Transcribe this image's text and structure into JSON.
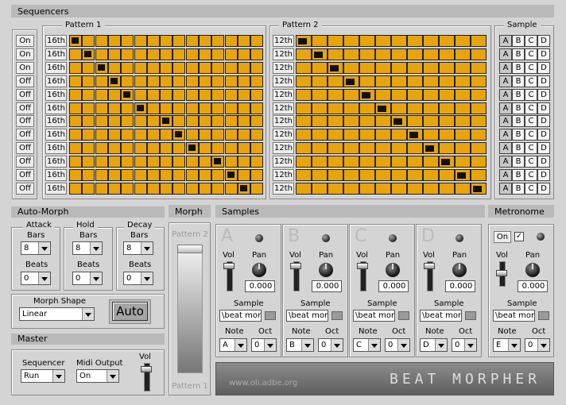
{
  "sequencers": {
    "title": "Sequencers",
    "pattern1_title": "Pattern 1",
    "pattern2_title": "Pattern 2",
    "sample_title": "Sample",
    "onoff": [
      "On",
      "On",
      "On",
      "Off",
      "Off",
      "Off",
      "Off",
      "Off",
      "Off",
      "Off",
      "Off",
      "Off"
    ],
    "p1_div": [
      "16th",
      "16th",
      "16th",
      "16th",
      "16th",
      "16th",
      "16th",
      "16th",
      "16th",
      "16th",
      "16th",
      "16th"
    ],
    "p2_div": [
      "12th",
      "12th",
      "12th",
      "12th",
      "12th",
      "12th",
      "12th",
      "12th",
      "12th",
      "12th",
      "12th",
      "12th"
    ],
    "p1_active": [
      0,
      1,
      2,
      3,
      4,
      5,
      7,
      8,
      9,
      11,
      12,
      13
    ],
    "p2_active": [
      0,
      1,
      2,
      3,
      4,
      5,
      6,
      7,
      8,
      9,
      10,
      11
    ],
    "sample_letters": [
      "A",
      "B",
      "C",
      "D"
    ]
  },
  "automorph": {
    "title": "Auto-Morph",
    "attack": "Attack",
    "hold": "Hold",
    "decay": "Decay",
    "bars": "Bars",
    "beats": "Beats",
    "attack_bars": "8",
    "attack_beats": "0",
    "hold_bars": "8",
    "hold_beats": "0",
    "decay_bars": "8",
    "decay_beats": "0",
    "morph_shape_label": "Morph Shape",
    "morph_shape": "Linear",
    "auto": "Auto"
  },
  "morph": {
    "title": "Morph",
    "top": "Pattern 2",
    "bottom": "Pattern 1"
  },
  "master": {
    "title": "Master",
    "sequencer_label": "Sequencer",
    "sequencer": "Run",
    "midi_label": "Midi Output",
    "midi": "On",
    "vol": "Vol"
  },
  "samples": {
    "title": "Samples",
    "channels": [
      {
        "letter": "A",
        "vol": "Vol",
        "pan": "Pan",
        "value": "0.000",
        "sample_label": "Sample",
        "sample": "\\beat morp",
        "note_label": "Note",
        "oct_label": "Oct",
        "note": "A",
        "oct": "0"
      },
      {
        "letter": "B",
        "vol": "Vol",
        "pan": "Pan",
        "value": "0.000",
        "sample_label": "Sample",
        "sample": "\\beat morp",
        "note_label": "Note",
        "oct_label": "Oct",
        "note": "B",
        "oct": "0"
      },
      {
        "letter": "C",
        "vol": "Vol",
        "pan": "Pan",
        "value": "0.000",
        "sample_label": "Sample",
        "sample": "\\beat morp",
        "note_label": "Note",
        "oct_label": "Oct",
        "note": "C",
        "oct": "0"
      },
      {
        "letter": "D",
        "vol": "Vol",
        "pan": "Pan",
        "value": "0.000",
        "sample_label": "Sample",
        "sample": "\\beat morp",
        "note_label": "Note",
        "oct_label": "Oct",
        "note": "D",
        "oct": "0"
      }
    ],
    "url": "www.oli.adbe.org",
    "logo": "BEAT MORPHER"
  },
  "metronome": {
    "title": "Metronome",
    "on": "On",
    "vol": "Vol",
    "pan": "Pan",
    "value": "0.000",
    "sample_label": "Sample",
    "sample": "\\beat morp",
    "note_label": "Note",
    "oct_label": "Oct",
    "note": "E",
    "oct": "0"
  }
}
